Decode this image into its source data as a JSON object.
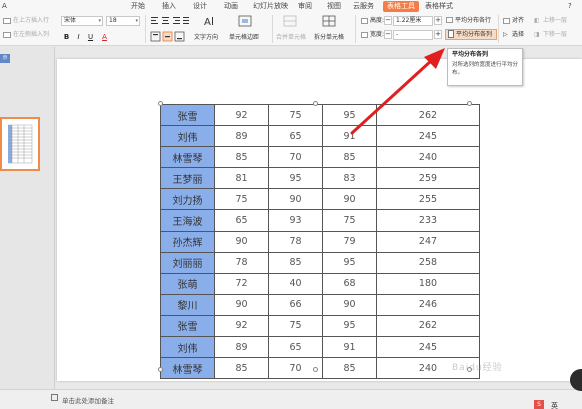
{
  "menu": {
    "tabs": [
      "开始",
      "插入",
      "设计",
      "动画",
      "幻灯片放映",
      "审阅",
      "视图",
      "云服务",
      "表格工具",
      "表格样式"
    ],
    "active_tab": "表格工具",
    "partial_left": "A",
    "partial_right": "?"
  },
  "ribbon": {
    "insert_row_above": "在上方插入行",
    "insert_col_left": "在左侧插入列",
    "font_name": "宋体",
    "font_size": "18",
    "text_direction": "文字方向",
    "cell_margin": "单元格边距",
    "merge_cells": "合并单元格",
    "split_cells": "拆分单元格",
    "height_label": "高度:",
    "height_value": "1.22厘米",
    "width_label": "宽度:",
    "width_value": "-",
    "distribute_rows": "平均分布各行",
    "distribute_cols": "平均分布各列",
    "align": "对齐",
    "select": "选择",
    "move_up": "上移一层",
    "move_down": "下移一层",
    "bold": "B",
    "italic": "I",
    "underline": "U",
    "font_color": "A",
    "step_minus": "−",
    "step_plus": "+"
  },
  "tooltip": {
    "title": "平均分布各列",
    "body": "对所选列的宽度进行平均分布。"
  },
  "left_pane": {
    "tag": "示"
  },
  "table": {
    "rows": [
      [
        "张雪",
        "92",
        "75",
        "95",
        "262"
      ],
      [
        "刘伟",
        "89",
        "65",
        "91",
        "245"
      ],
      [
        "林雪琴",
        "85",
        "70",
        "85",
        "240"
      ],
      [
        "王梦丽",
        "81",
        "95",
        "83",
        "259"
      ],
      [
        "刘力扬",
        "75",
        "90",
        "90",
        "255"
      ],
      [
        "王海波",
        "65",
        "93",
        "75",
        "233"
      ],
      [
        "孙杰辉",
        "90",
        "78",
        "79",
        "247"
      ],
      [
        "刘丽丽",
        "78",
        "85",
        "95",
        "258"
      ],
      [
        "张萌",
        "72",
        "40",
        "68",
        "180"
      ],
      [
        "黎川",
        "90",
        "66",
        "90",
        "246"
      ],
      [
        "张雪",
        "92",
        "75",
        "95",
        "262"
      ],
      [
        "刘伟",
        "89",
        "65",
        "91",
        "245"
      ],
      [
        "林雪琴",
        "85",
        "70",
        "85",
        "240"
      ]
    ]
  },
  "status": {
    "note_placeholder": "单击此处添加备注",
    "lang": "英",
    "badge": "S"
  },
  "watermark": "Baidu经验",
  "colors": {
    "active_tab": "#f47c45",
    "name_cell": "#8aaee9",
    "arrow": "#e02020",
    "thumb_border": "#f08c4a",
    "highlight": "#f6dcc7"
  }
}
